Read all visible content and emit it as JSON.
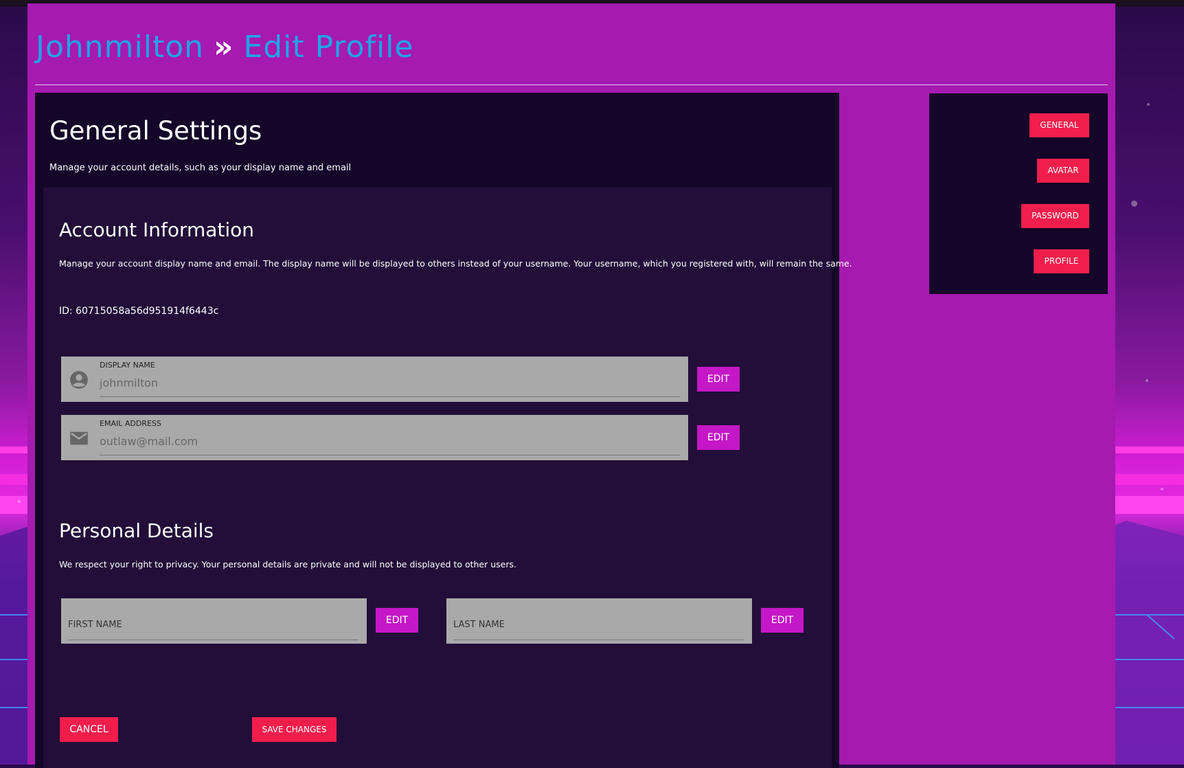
{
  "breadcrumb": {
    "user": "Johnmilton",
    "separator": "»",
    "page": "Edit Profile"
  },
  "general": {
    "title": "General Settings",
    "subtitle": "Manage your account details, such as your display name and email"
  },
  "account": {
    "title": "Account Information",
    "description": "Manage your account display name and email. The display name will be displayed to others instead of your username. Your username, which you registered with, will remain the same.",
    "id_text": "ID: 60715058a56d951914f6443c",
    "display_name": {
      "label": "DISPLAY NAME",
      "value": "johnmilton",
      "icon": "account-circle-icon",
      "edit_label": "EDIT"
    },
    "email": {
      "label": "EMAIL ADDRESS",
      "value": "outlaw@mail.com",
      "icon": "mail-icon",
      "edit_label": "EDIT"
    }
  },
  "personal": {
    "title": "Personal Details",
    "description": "We respect your right to privacy. Your personal details are private and will not be displayed to other users.",
    "first_name": {
      "label": "FIRST NAME",
      "edit_label": "EDIT"
    },
    "last_name": {
      "label": "LAST NAME",
      "edit_label": "EDIT"
    }
  },
  "actions": {
    "cancel": "CANCEL",
    "save": "SAVE CHANGES"
  },
  "sidenav": {
    "general": "GENERAL",
    "avatar": "AVATAR",
    "password": "PASSWORD",
    "profile": "PROFILE"
  },
  "colors": {
    "accent_blue": "#1fa4e6",
    "edit_purple": "#c417c6",
    "action_red": "#f11e4c",
    "panel_bg": "#140628",
    "card_bg": "#220e38"
  }
}
